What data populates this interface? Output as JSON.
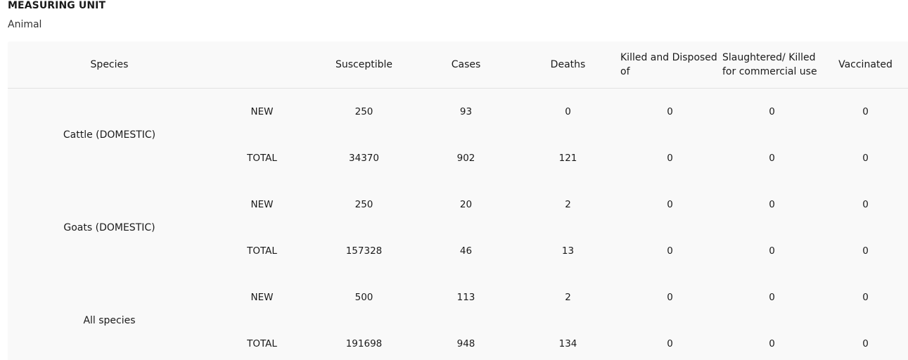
{
  "measuring_unit": {
    "title": "MEASURING UNIT",
    "value": "Animal"
  },
  "table": {
    "headers": {
      "species": "Species",
      "type": "",
      "susceptible": "Susceptible",
      "cases": "Cases",
      "deaths": "Deaths",
      "killed": "Killed and Disposed of",
      "slaughtered": "Slaughtered/ Killed for commercial use",
      "vaccinated": "Vaccinated"
    },
    "groups": [
      {
        "species": "Cattle (DOMESTIC)",
        "rows": [
          {
            "type": "NEW",
            "susceptible": "250",
            "cases": "93",
            "deaths": "0",
            "killed": "0",
            "slaughtered": "0",
            "vaccinated": "0"
          },
          {
            "type": "TOTAL",
            "susceptible": "34370",
            "cases": "902",
            "deaths": "121",
            "killed": "0",
            "slaughtered": "0",
            "vaccinated": "0"
          }
        ]
      },
      {
        "species": "Goats (DOMESTIC)",
        "rows": [
          {
            "type": "NEW",
            "susceptible": "250",
            "cases": "20",
            "deaths": "2",
            "killed": "0",
            "slaughtered": "0",
            "vaccinated": "0"
          },
          {
            "type": "TOTAL",
            "susceptible": "157328",
            "cases": "46",
            "deaths": "13",
            "killed": "0",
            "slaughtered": "0",
            "vaccinated": "0"
          }
        ]
      },
      {
        "species": "All species",
        "rows": [
          {
            "type": "NEW",
            "susceptible": "500",
            "cases": "113",
            "deaths": "2",
            "killed": "0",
            "slaughtered": "0",
            "vaccinated": "0"
          },
          {
            "type": "TOTAL",
            "susceptible": "191698",
            "cases": "948",
            "deaths": "134",
            "killed": "0",
            "slaughtered": "0",
            "vaccinated": "0"
          }
        ]
      }
    ]
  }
}
